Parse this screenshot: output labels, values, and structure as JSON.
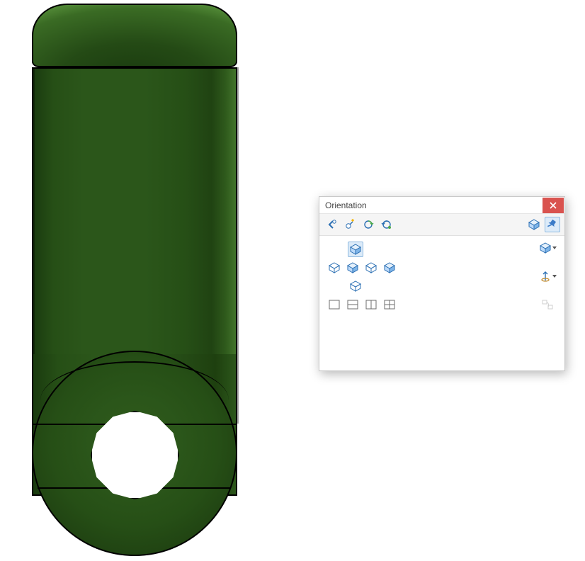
{
  "panel": {
    "title": "Orientation",
    "close_label": "Close",
    "toolbar": {
      "prev_view": "Previous View",
      "new_view": "New View",
      "update_views": "Update Standard Views",
      "reset_views": "Reset Standard Views",
      "view_selector": "View Selector",
      "pin": "Pin"
    },
    "views": {
      "isometric": "Isometric",
      "front": "Front",
      "back": "Back",
      "left": "Left",
      "right": "Right",
      "top": "Top",
      "trimetric": "Trimetric",
      "normal_to": "Normal To",
      "axis_triad": "Axis Triad",
      "link_views": "Link Views"
    },
    "viewports": {
      "single": "Single View",
      "two_h": "Two View Horizontal",
      "two_v": "Two View Vertical",
      "four": "Four View"
    }
  },
  "part": {
    "color": "#2b561a"
  }
}
